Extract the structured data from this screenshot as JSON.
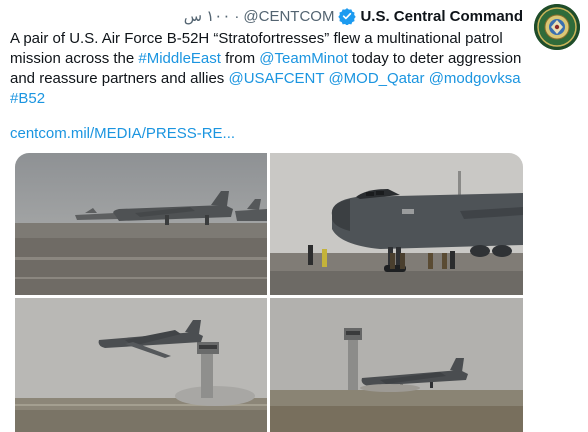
{
  "tweet": {
    "display_name": "U.S. Central Command",
    "handle": "@CENTCOM",
    "separator": "·",
    "timestamp": "١٠٠ س",
    "text_parts": [
      {
        "t": "A pair of U.S. Air Force B-52H “Stratofortresses” flew a multinational patrol mission across the ",
        "link": false
      },
      {
        "t": "#MiddleEast",
        "link": true
      },
      {
        "t": " from ",
        "link": false
      },
      {
        "t": "@TeamMinot",
        "link": true
      },
      {
        "t": " today to deter aggression and reassure partners and allies ",
        "link": false
      },
      {
        "t": "@USAFCENT",
        "link": true
      },
      {
        "t": " ",
        "link": false
      },
      {
        "t": "@MOD_Qatar",
        "link": true
      },
      {
        "t": " ",
        "link": false
      },
      {
        "t": "@modgovksa",
        "link": true
      },
      {
        "t": " ",
        "link": false
      },
      {
        "t": "#B52",
        "link": true
      }
    ],
    "url": "centcom.mil/MEDIA/PRESS-RE..."
  },
  "colors": {
    "link": "#1b95e0",
    "verified": "#1d9bf0",
    "secondary_text": "#536471",
    "avatar_bg": "#1f4d2a"
  },
  "icons": {
    "verified": "verified-badge-icon",
    "avatar": "centcom-seal-avatar"
  },
  "photos": [
    {
      "subject": "b52-parked-on-ramp"
    },
    {
      "subject": "b52-nose-with-ground-crew"
    },
    {
      "subject": "b52-takeoff-left-tower"
    },
    {
      "subject": "b52-takeoff-right-tower"
    }
  ]
}
